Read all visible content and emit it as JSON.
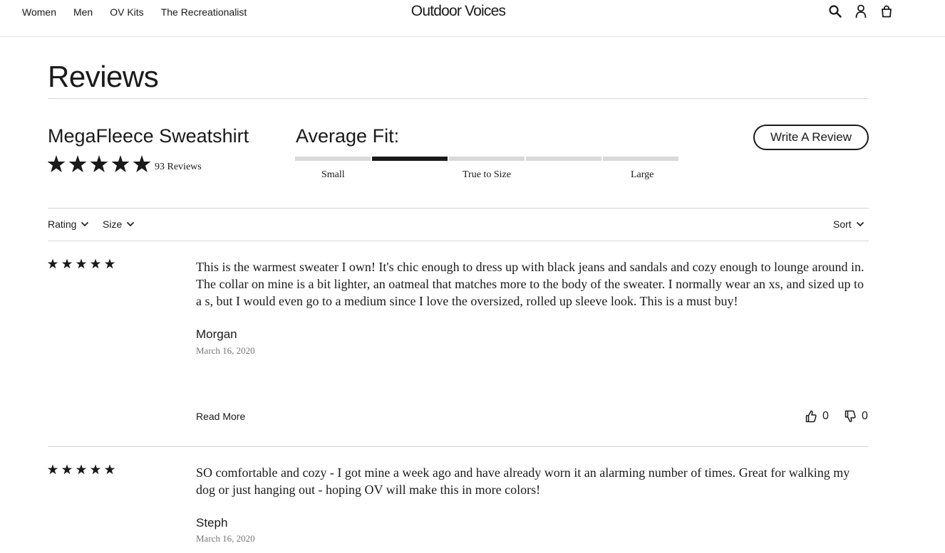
{
  "nav": {
    "items": [
      "Women",
      "Men",
      "OV Kits",
      "The Recreationalist"
    ],
    "brand": "Outdoor Voices",
    "icons": [
      "search-icon",
      "account-icon",
      "bag-icon"
    ]
  },
  "reviews": {
    "title": "Reviews",
    "product_name": "MegaFleece Sweatshirt",
    "rating": 5,
    "review_count": "93 Reviews",
    "write_review_label": "Write A Review"
  },
  "fit": {
    "title": "Average Fit:",
    "labels": [
      "Small",
      "True to Size",
      "Large"
    ],
    "segments": 5,
    "active_segment": 2
  },
  "filters": {
    "rating_label": "Rating",
    "size_label": "Size",
    "sort_label": "Sort"
  },
  "review_list": [
    {
      "stars": 5,
      "text": "This is the warmest sweater I own! It's chic enough to dress up with black jeans and sandals and cozy enough to lounge around in. The collar on mine is a bit lighter, an oatmeal that matches more to the body of the sweater. I normally wear an xs, and sized up to a s, but I would even go to a medium since I love the oversized, rolled up sleeve look. This is a must buy!",
      "author": "Morgan",
      "date": "March 16, 2020",
      "read_more": "Read More",
      "helpful_up": "0",
      "helpful_down": "0"
    },
    {
      "stars": 5,
      "text": "SO comfortable and cozy - I got mine a week ago and have already worn it an alarming number of times. Great for walking my dog or just hanging out - hoping OV will make this in more colors!",
      "author": "Steph",
      "date": "March 16, 2020"
    }
  ],
  "colors": {
    "text": "#1a1a1a",
    "muted": "#777777",
    "rule": "#d6d6d6",
    "fit_inactive": "#d9d9d9"
  }
}
